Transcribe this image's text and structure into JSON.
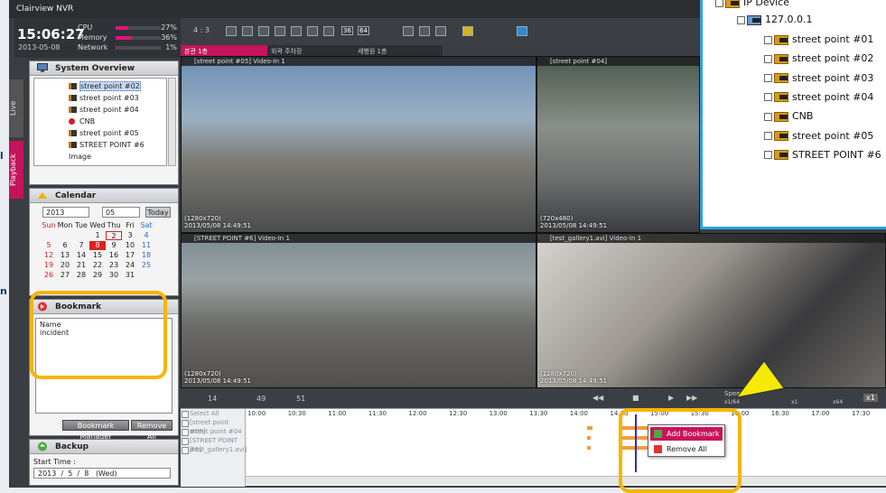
{
  "app": {
    "title": "Clairview NVR"
  },
  "status": {
    "time": "15:06:27",
    "date": "2013-05-08",
    "meters": [
      {
        "label": "CPU",
        "value": "27%",
        "fraction": 0.27
      },
      {
        "label": "Memory",
        "value": "36%",
        "fraction": 0.36
      },
      {
        "label": "Network",
        "value": "1%",
        "fraction": 0.01
      }
    ]
  },
  "side_tabs": {
    "live": "Live",
    "playback": "Playback"
  },
  "system_overview": {
    "title": "System Overview",
    "items": [
      "street point #02",
      "street point #03",
      "street point #04",
      "CNB",
      "street point #05",
      "STREET POINT #6",
      "Image"
    ]
  },
  "calendar": {
    "title": "Calendar",
    "year": "2013",
    "month": "05",
    "today_label": "Today",
    "weekdays": [
      "Sun",
      "Mon",
      "Tue",
      "Wed",
      "Thu",
      "Fri",
      "Sat"
    ],
    "weeks": [
      [
        "",
        "",
        "",
        "1",
        "2",
        "3",
        "4"
      ],
      [
        "5",
        "6",
        "7",
        "8",
        "9",
        "10",
        "11"
      ],
      [
        "12",
        "13",
        "14",
        "15",
        "16",
        "17",
        "18"
      ],
      [
        "19",
        "20",
        "21",
        "22",
        "23",
        "24",
        "25"
      ],
      [
        "26",
        "27",
        "28",
        "29",
        "30",
        "31",
        ""
      ]
    ],
    "selected_day": "8"
  },
  "bookmark": {
    "title": "Bookmark",
    "column": "Name",
    "entries": [
      "incident"
    ],
    "manager_label": "Bookmark Manager",
    "remove_all_label": "Remove All"
  },
  "backup": {
    "title": "Backup",
    "start_label": "Start Time :",
    "year": "2013",
    "month": "5",
    "day": "8",
    "weekday": "(Wed)"
  },
  "toolbar": {
    "aspect": "4 : 3",
    "layout_36": "36",
    "layout_64": "64"
  },
  "tabs": [
    "본관 1층",
    "외곽 주차장",
    "세병원 1층"
  ],
  "videos": [
    {
      "header": "[street point #05] Video-In 1",
      "res": "(1280x720)",
      "time": "2013/05/08 14:49:51"
    },
    {
      "header": "[street point #04]",
      "res": "(720x480)",
      "time": "2013/05/08 14:49:51"
    },
    {
      "header": "[STREET POINT #6] Video-In 1",
      "res": "(1280x720)",
      "time": "2013/05/08 14:49:51"
    },
    {
      "header": "[test_gallery1.avi] Video-In 1",
      "res": "(1280x720)",
      "time": "2013/05/08 14:49:51"
    }
  ],
  "timeline": {
    "hours": [
      "14",
      "49",
      "51"
    ],
    "speed_label": "Speed",
    "speed_marks": [
      "x1/64",
      "x1",
      "x64"
    ],
    "speed_value": "x1",
    "rows": [
      "Select All",
      "[street point #05]",
      "street point #04",
      "[STREET POINT #6]",
      "[test_gallery1.avi]"
    ],
    "ticks": [
      "10:00",
      "10:30",
      "11:00",
      "11:30",
      "12:00",
      "12:30",
      "13:00",
      "13:30",
      "14:00",
      "14:30",
      "15:00",
      "15:30",
      "16:00",
      "16:30",
      "17:00",
      "17:30"
    ]
  },
  "context_menu": {
    "add_bookmark": "Add Bookmark",
    "remove_all": "Remove All"
  },
  "device_tree": {
    "root": "IP Device",
    "host": "127.0.0.1",
    "items": [
      "street point #01",
      "street point #02",
      "street point #03",
      "street point #04",
      "CNB",
      "street point #05",
      "STREET POINT #6"
    ]
  },
  "colors": {
    "accent": "#e0157a",
    "highlight": "#f6b400",
    "popup_border": "#29a3e0",
    "segment": "#f29d3a"
  }
}
